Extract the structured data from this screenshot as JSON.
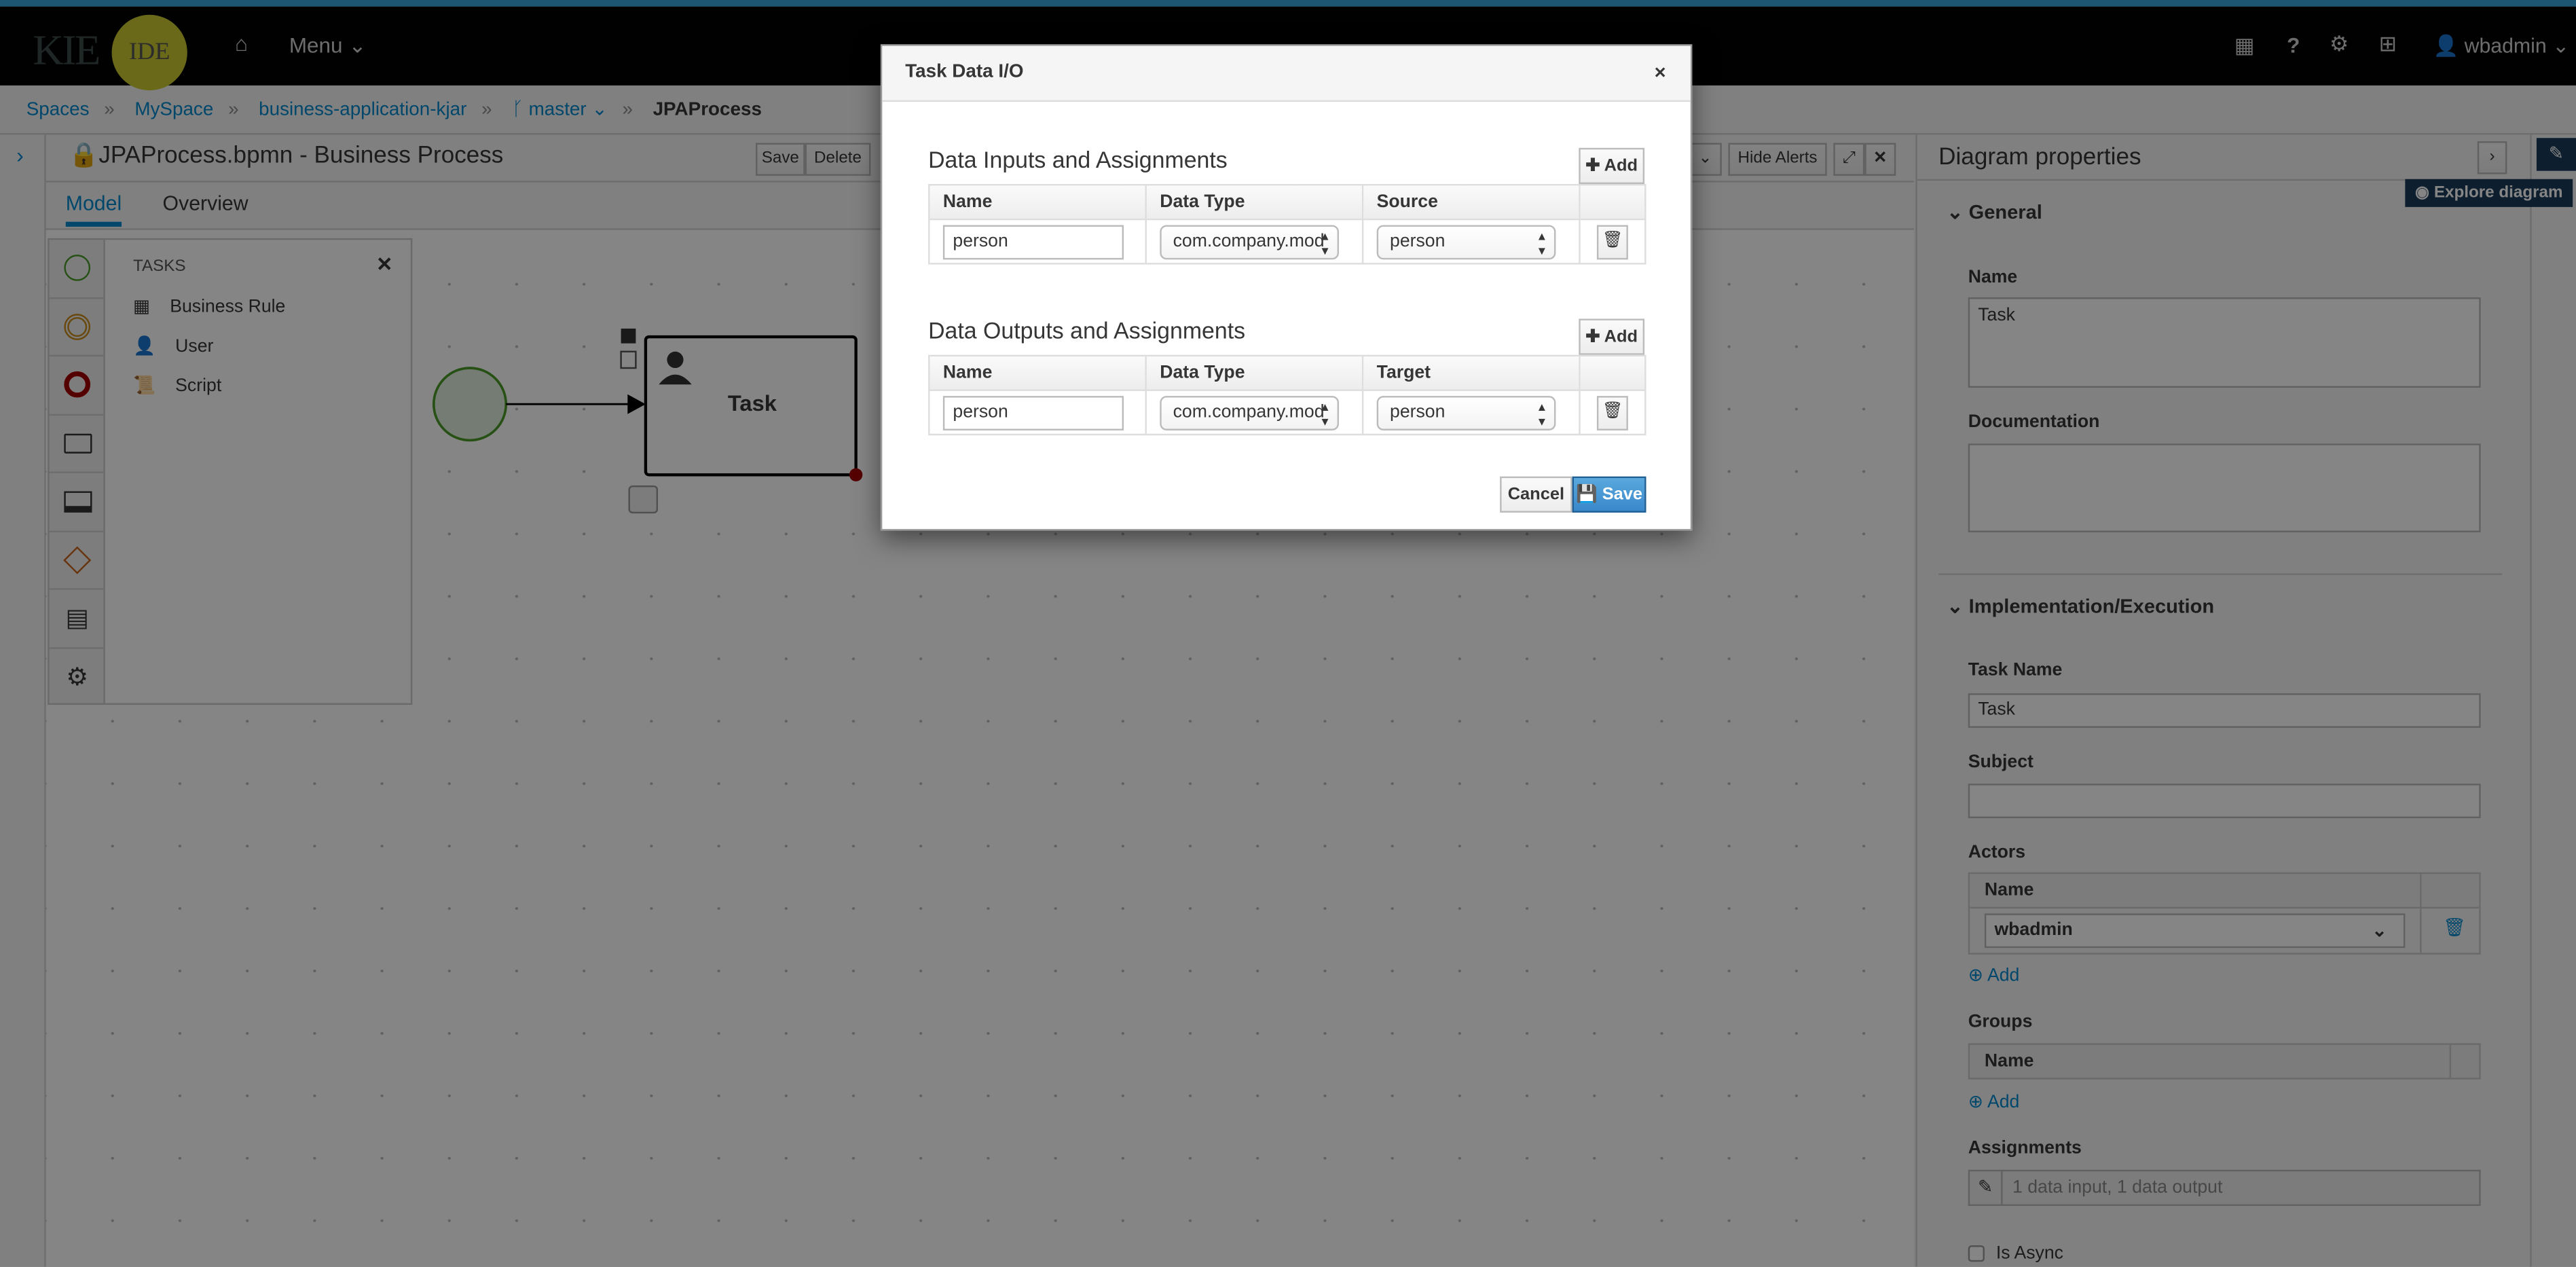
{
  "header": {
    "logo_text": "KIE",
    "logo_badge": "IDE",
    "menu_label": "Menu",
    "user": "wbadmin",
    "icons": [
      "home-icon",
      "apps-grid-icon",
      "help-icon",
      "gear-icon",
      "medkit-icon",
      "user-icon"
    ]
  },
  "breadcrumb": {
    "items": [
      "Spaces",
      "MySpace",
      "business-application-kjar"
    ],
    "branch": "master",
    "current": "JPAProcess"
  },
  "editor": {
    "title": "JPAProcess.bpmn - Business Process",
    "toolbar": {
      "save": "Save",
      "delete": "Delete",
      "hide_alerts": "Hide Alerts"
    },
    "tabs": [
      "Model",
      "Overview"
    ],
    "active_tab": "Model"
  },
  "palette": {
    "flyout_title": "TASKS",
    "items": [
      "Business Rule",
      "User",
      "Script"
    ]
  },
  "canvas": {
    "task_label": "Task"
  },
  "properties": {
    "title": "Diagram properties",
    "explore": "Explore diagram",
    "general": "General",
    "name_label": "Name",
    "name_value": "Task",
    "documentation_label": "Documentation",
    "documentation_value": "",
    "impl": "Implementation/Execution",
    "task_name_label": "Task Name",
    "task_name_value": "Task",
    "subject_label": "Subject",
    "subject_value": "",
    "actors_label": "Actors",
    "actors_col": "Name",
    "actors": [
      "wbadmin"
    ],
    "add": "Add",
    "groups_label": "Groups",
    "groups_col": "Name",
    "assignments_label": "Assignments",
    "assignments_value": "1 data input, 1 data output",
    "is_async": "Is Async"
  },
  "modal": {
    "title": "Task Data I/O",
    "inputs": {
      "title": "Data Inputs and Assignments",
      "add": "Add",
      "columns": [
        "Name",
        "Data Type",
        "Source"
      ],
      "rows": [
        {
          "name": "person",
          "type": "com.company.mod",
          "source": "person"
        }
      ]
    },
    "outputs": {
      "title": "Data Outputs and Assignments",
      "add": "Add",
      "columns": [
        "Name",
        "Data Type",
        "Target"
      ],
      "rows": [
        {
          "name": "person",
          "type": "com.company.mod",
          "target": "person"
        }
      ]
    },
    "cancel": "Cancel",
    "save": "Save"
  },
  "colors": {
    "link": "#0088ce",
    "primary": "#3f9ad6",
    "header": "#030303",
    "logo": "#c9c930"
  }
}
